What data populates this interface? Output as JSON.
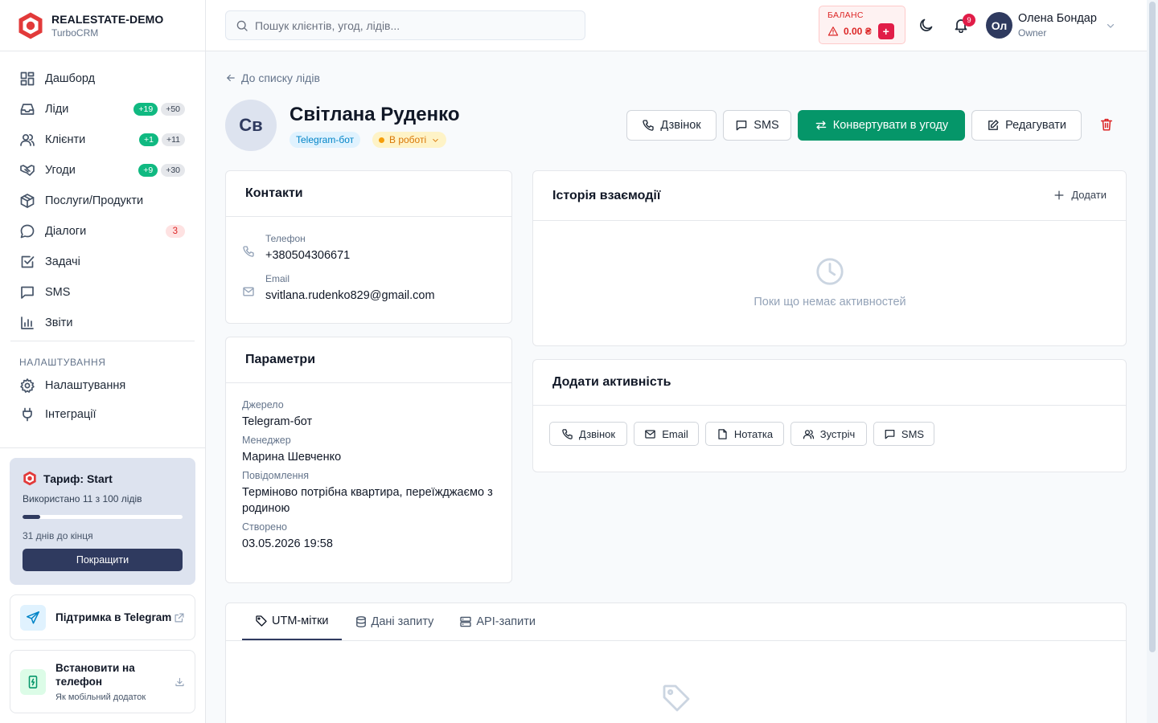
{
  "brand": {
    "name": "REALESTATE-DEMO",
    "sub": "TurboCRM"
  },
  "nav": {
    "dashboard": "Дашборд",
    "leads": {
      "label": "Ліди",
      "new": "+19",
      "total": "+50"
    },
    "clients": {
      "label": "Клієнти",
      "new": "+1",
      "total": "+11"
    },
    "deals": {
      "label": "Угоди",
      "new": "+9",
      "total": "+30"
    },
    "services": "Послуги/Продукти",
    "dialogs": {
      "label": "Діалоги",
      "count": "3"
    },
    "tasks": "Задачі",
    "sms": "SMS",
    "reports": "Звіти",
    "section_settings": "НАЛАШТУВАННЯ",
    "settings": "Налаштування",
    "integrations": "Інтеграції"
  },
  "plan": {
    "title": "Тариф: Start",
    "used": "Використано 11 з 100 лідів",
    "used_fraction": 0.11,
    "days_left": "31 днів до кінця",
    "upgrade": "Покращити"
  },
  "support": {
    "title": "Підтримка в Telegram"
  },
  "install": {
    "title": "Встановити на телефон",
    "sub": "Як мобільний додаток"
  },
  "header": {
    "search_placeholder": "Пошук клієнтів, угод, лідів...",
    "balance_label": "БАЛАНС",
    "balance_value": "0.00 ₴",
    "balance_add": "+",
    "notifications": "9",
    "user_initials": "Ол",
    "user_name": "Олена Бондар",
    "user_role": "Owner"
  },
  "lead": {
    "back": "До списку лідів",
    "initials": "Св",
    "name": "Світлана Руденко",
    "source_tag": "Telegram-бот",
    "status": "В роботі"
  },
  "actions": {
    "call": "Дзвінок",
    "sms": "SMS",
    "convert": "Конвертувати в угоду",
    "edit": "Редагувати"
  },
  "contacts": {
    "title": "Контакти",
    "phone_label": "Телефон",
    "phone": "+380504306671",
    "email_label": "Email",
    "email": "svitlana.rudenko829@gmail.com"
  },
  "params": {
    "title": "Параметри",
    "source_label": "Джерело",
    "source": "Telegram-бот",
    "manager_label": "Менеджер",
    "manager": "Марина Шевченко",
    "message_label": "Повідомлення",
    "message": "Терміново потрібна квартира, переїжджаємо з родиною",
    "created_label": "Створено",
    "created": "03.05.2026 19:58"
  },
  "history": {
    "title": "Історія взаємодії",
    "add": "Додати",
    "empty": "Поки що немає активностей"
  },
  "add_activity": {
    "title": "Додати активність",
    "call": "Дзвінок",
    "email": "Email",
    "note": "Нотатка",
    "meeting": "Зустріч",
    "sms": "SMS"
  },
  "tabs": {
    "utm": "UTM-мітки",
    "request": "Дані запиту",
    "api": "API-запити"
  },
  "colors": {
    "accent": "#2f3a5f",
    "green": "#059669",
    "danger": "#dc2626"
  }
}
